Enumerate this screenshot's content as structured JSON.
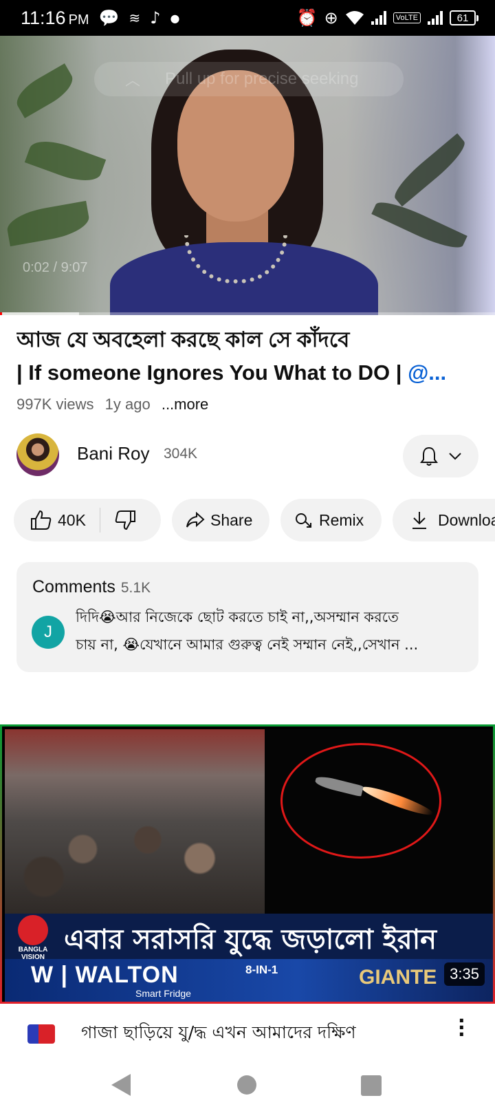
{
  "status_bar": {
    "time": "11:16",
    "ampm": "PM",
    "volte": "VoLTE",
    "battery": "61"
  },
  "player": {
    "seek_hint": "Pull up for precise seeking",
    "timecode": "0:02 / 9:07",
    "progress_fraction": 0.004,
    "buffer_fraction": 0.16
  },
  "video": {
    "title_line1": "আজ যে অবহেলা করছে কাল সে কাঁদবে",
    "title_line2": "| If someone Ignores You What to DO | ",
    "title_handle": "@...",
    "views": "997K views",
    "age": "1y ago",
    "more": "...more"
  },
  "channel": {
    "name": "Bani Roy",
    "subscribers": "304K"
  },
  "actions": {
    "likes": "40K",
    "share": "Share",
    "remix": "Remix",
    "download": "Download"
  },
  "comments": {
    "title": "Comments",
    "count": "5.1K",
    "avatar_letter": "J",
    "line1": "দিদি😭আর নিজেকে  ছোট করতে চাই না,,অসম্মান করতে",
    "line2": "চায় না, 😭যেখানে আমার গুরুত্ব নেই  সম্মান নেই,,সেখান ..."
  },
  "next_video": {
    "headline": "এবার সরাসরি যুদ্ধে জড়ালো ইরান",
    "logo_text": "BANGLA VISION",
    "ad_brand": "WALTON",
    "ad_sub": "Smart Fridge",
    "ad_mid": "8-IN-1",
    "ad_right": "GIANTE",
    "duration": "3:35",
    "title": "গাজা ছাড়িয়ে যু/দ্ধ এখন আমাদের দক্ষিণ"
  },
  "colors": {
    "accent_red": "#ff0000",
    "link_blue": "#065fd4",
    "pill_bg": "#f2f2f2",
    "comment_avatar": "#12a4a4"
  },
  "icons": [
    "message-icon",
    "wifi-calling-icon",
    "tiktok-icon",
    "alarm-icon",
    "data-saver-icon",
    "wifi-icon",
    "signal-icon",
    "battery-icon",
    "bell-icon",
    "chevron-down-icon",
    "thumbs-up-icon",
    "thumbs-down-icon",
    "share-icon",
    "remix-icon",
    "download-icon",
    "more-vert-icon",
    "back-icon",
    "home-icon",
    "recents-icon"
  ]
}
